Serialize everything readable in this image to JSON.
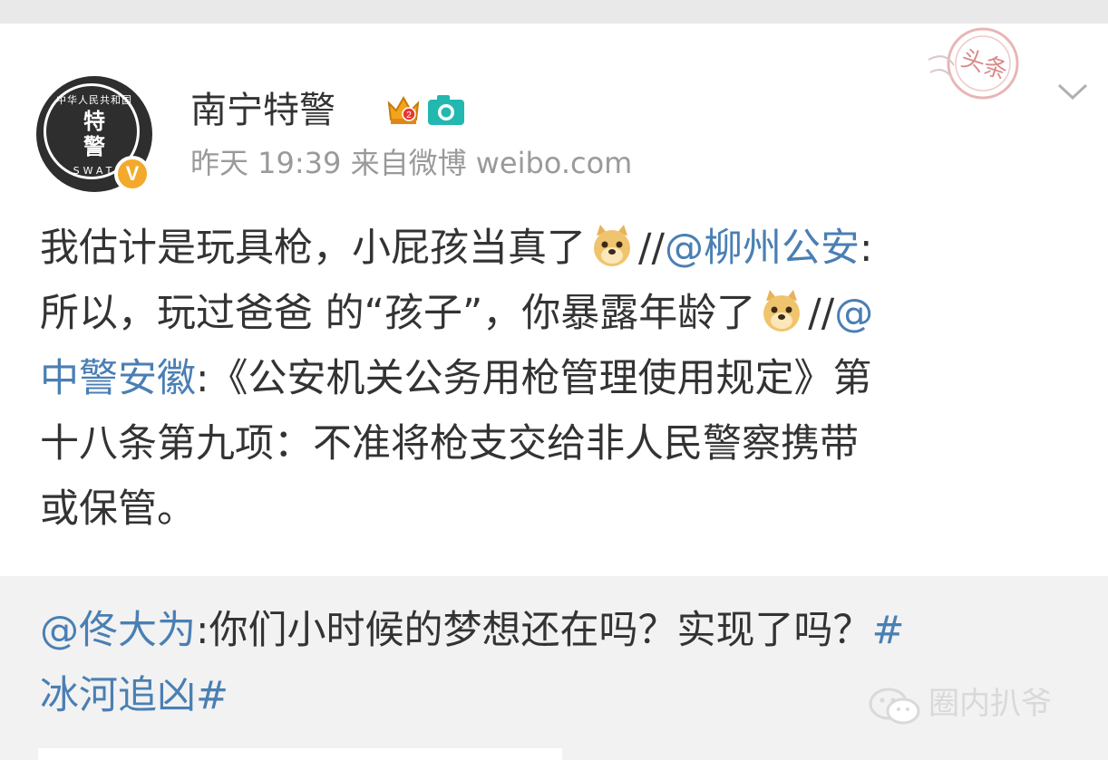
{
  "post": {
    "username": "南宁特警",
    "meta": "昨天 19:39  来自微博 weibo.com",
    "avatar": {
      "ring_text": "中华人民共和国",
      "char1": "特",
      "char2": "警",
      "swat": "SWAT",
      "verified_badge": "V"
    },
    "stamp_text": "头条",
    "lines": [
      {
        "a": "我估计是玩具枪，小屁孩当真了",
        "b": "//",
        "mention": "@柳州公安",
        "c": ":"
      },
      {
        "a": "所以，玩过爸爸 的“孩子”，你暴露年龄了",
        "b": "//",
        "mention": "@"
      },
      {
        "mention": "中警安徽",
        "c": ":《公安机关公务用枪管理使用规定》第"
      },
      {
        "a": "十八条第九项：不准将枪支交给非人民警察携带"
      },
      {
        "a": "或保管。"
      }
    ]
  },
  "repost": {
    "line1_mention": "@佟大为",
    "line1_text": ":你们小时候的梦想还在吗？实现了吗？",
    "line1_hash": "#",
    "line2_hash": "冰河追凶#"
  },
  "watermark": {
    "text": "圈内扒爷"
  },
  "colors": {
    "link": "#4a7fb3",
    "text": "#333333",
    "meta": "#9a9a9a",
    "badge": "#f3a92b",
    "repost_bg": "#f2f2f2"
  },
  "icons": [
    "crown-icon",
    "camera-icon",
    "chevron-down-icon",
    "doge-emoji",
    "wechat-icon",
    "verified-icon"
  ]
}
